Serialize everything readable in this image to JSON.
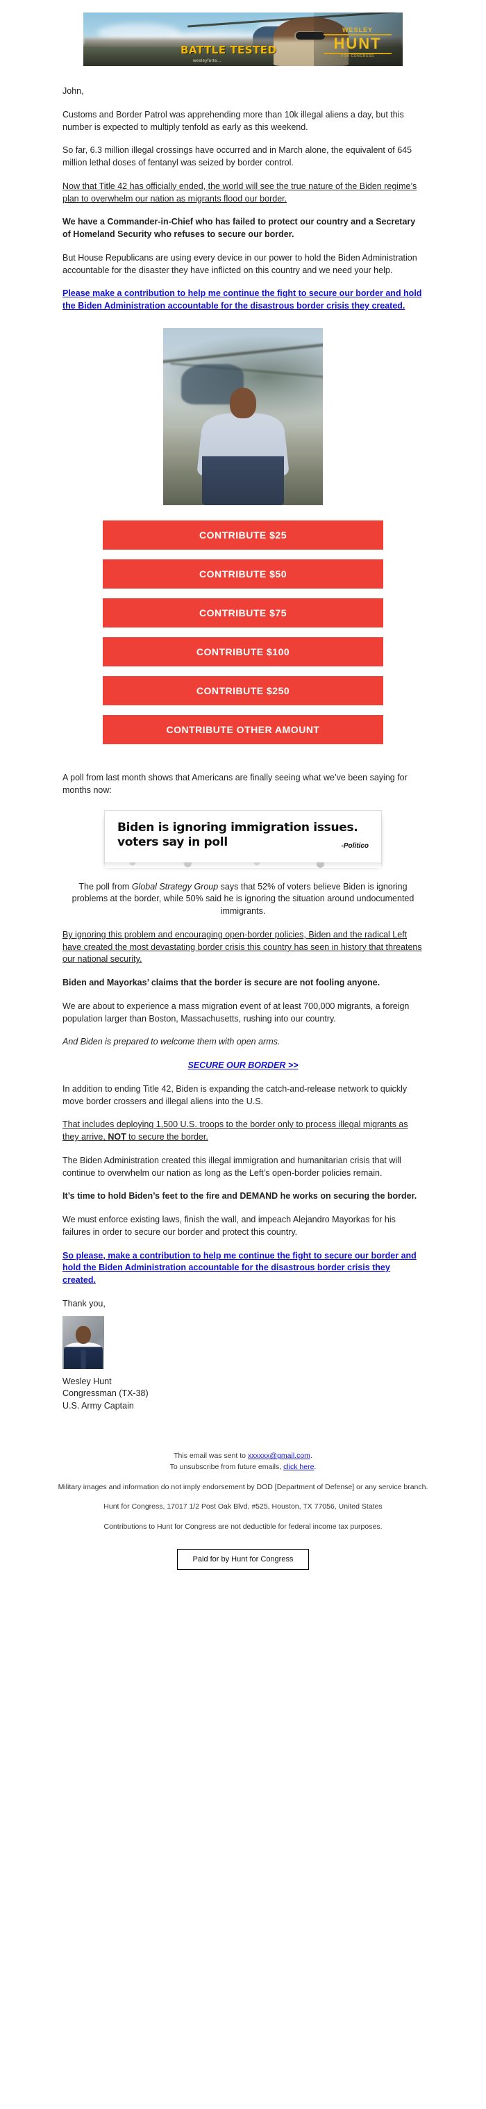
{
  "header": {
    "battle_tested": "BATTLE TESTED",
    "battle_url": "wesleyforte...",
    "logo_wesley": "WESLEY",
    "logo_hunt": "HUNT",
    "logo_sub": "FOR CONGRESS",
    "alt": "Wesley Hunt in front of military helicopter"
  },
  "colors": {
    "button_red": "#EE4036",
    "alert_red": "#E01B1B",
    "link_blue": "#1414D0",
    "logo_gold": "#EEBC1D"
  },
  "body": {
    "salutation": "John,",
    "p1": "Customs and Border Patrol was apprehending more than 10k illegal aliens a day, but this number is expected to multiply tenfold as early as this weekend.",
    "p2": "So far, 6.3 million illegal crossings have occurred and in March alone, the equivalent of 645 million lethal doses of fentanyl was seized by border control.",
    "p3_underline": "Now that Title 42 has officially ended, the world will see the true nature of the Biden regime’s plan to overwhelm our nation as migrants flood our border.",
    "p4_red": "We have a Commander-in-Chief who has failed to protect our country and a Secretary of Homeland Security who refuses to secure our border.",
    "p5": "But House Republicans are using every device in our power to hold the Biden Administration accountable for the disaster they have inflicted on this country and we need your help.",
    "p6_link": "Please make a contribution to help me continue the fight to secure our border and hold the Biden Administration accountable for the disastrous border crisis they created.",
    "p7": "A poll from last month shows that Americans are finally seeing what we’ve been saying for months now:",
    "p8_red_pre": "The poll from ",
    "p8_red_italic": "Global Strategy Group",
    "p8_red_post": " says that 52% of voters believe Biden is ignoring problems at the border, while 50% said he is ignoring the situation around undocumented immigrants.",
    "p9_underline": "By ignoring this problem and encouraging open-border policies, Biden and the radical Left have created the most devastating border crisis this country has seen in history that threatens our national security.",
    "p10_bold": "Biden and Mayorkas’ claims that the border is secure are not fooling anyone.",
    "p11": "We are about to experience a mass migration event of at least 700,000 migrants, a foreign population larger than Boston, Massachusetts, rushing into our country.",
    "p12_italic": "And Biden is prepared to welcome them with open arms.",
    "cta_link": "SECURE OUR BORDER >>",
    "p13": "In addition to ending Title 42, Biden is expanding the catch-and-release network to quickly move border crossers and illegal aliens into the U.S.",
    "p14_u_pre": "That includes deploying 1,500 U.S. troops to the border only to process illegal migrants as they arrive, ",
    "p14_u_bold": "NOT",
    "p14_u_post": " to secure the border.",
    "p15": "The Biden Administration created this illegal immigration and humanitarian crisis that will continue to overwhelm our nation as long as the Left’s open-border policies remain.",
    "p16_bold": "It’s time to hold Biden’s feet to the fire and DEMAND he works on securing the border.",
    "p17": "We must enforce existing laws, finish the wall, and impeach Alejandro Mayorkas for his failures in order to secure our border and protect this country.",
    "p18_link": "So please, make a contribution to help me continue the fight to secure our border and hold the Biden Administration accountable for the disastrous border crisis they created.",
    "thank_you": "Thank you,"
  },
  "buttons": [
    {
      "label": "CONTRIBUTE $25"
    },
    {
      "label": "CONTRIBUTE $50"
    },
    {
      "label": "CONTRIBUTE $75"
    },
    {
      "label": "CONTRIBUTE $100"
    },
    {
      "label": "CONTRIBUTE $250"
    },
    {
      "label": "CONTRIBUTE OTHER AMOUNT"
    }
  ],
  "clipping": {
    "headline_line1": "Biden is ignoring immigration issues.",
    "headline_line2": "voters say in poll",
    "source": "-Politico"
  },
  "signature": {
    "name": "Wesley Hunt",
    "title": "Congressman (TX-38)",
    "rank": "U.S. Army Captain"
  },
  "footer": {
    "sent_pre": "This email was sent to ",
    "sent_email": "xxxxxx@gmail.com",
    "sent_post": ".",
    "unsub_pre": "To unsubscribe from future emails, ",
    "unsub_link": "click here",
    "unsub_post": ".",
    "disclaimer": "Military images and information do not imply endorsement by DOD [Department of Defense] or any service branch.",
    "address": "Hunt for Congress, 17017 1/2 Post Oak Blvd, #525, Houston, TX 77056, United States",
    "tax": "Contributions to Hunt for Congress are not deductible for federal income tax purposes.",
    "paid_for": "Paid for by Hunt for Congress"
  }
}
